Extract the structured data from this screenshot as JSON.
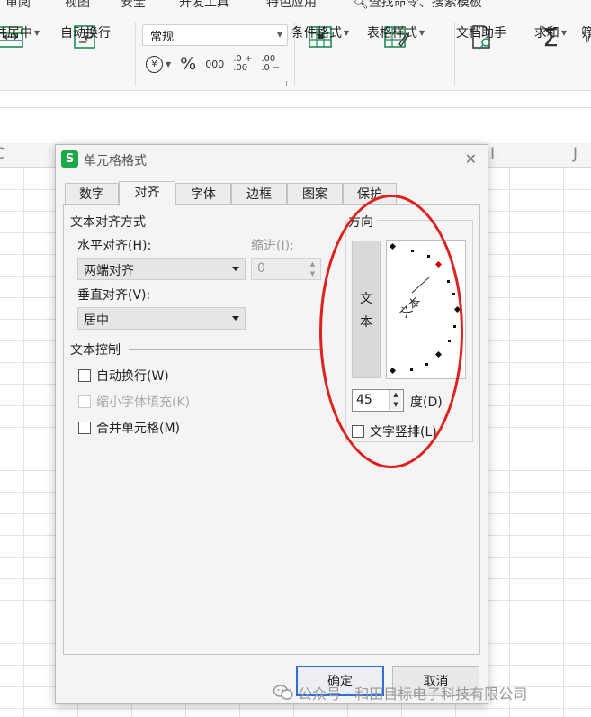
{
  "menu": {
    "items": [
      "审阅",
      "视图",
      "安全",
      "开发工具",
      "特色应用",
      "查找命令、搜索模板"
    ]
  },
  "ribbon": {
    "merge_center": "合并居中",
    "wrap_text": "自动换行",
    "number_format": "常规",
    "currency_symbol": "¥",
    "percent_symbol": "%",
    "thousands_symbol": "000",
    "increase_decimal": ".0 +\n.00",
    "decrease_decimal": ".00\n.0 −",
    "conditional_format": "条件格式",
    "table_style": "表格样式",
    "doc_assistant": "文档助手",
    "sum": "求和",
    "filter_partial": "筛"
  },
  "columns": [
    "C",
    "I",
    "J"
  ],
  "dialog": {
    "title": "单元格格式",
    "tabs": [
      "数字",
      "对齐",
      "字体",
      "边框",
      "图案",
      "保护"
    ],
    "active_tab": "对齐",
    "text_alignment_group": "文本对齐方式",
    "horizontal_label": "水平对齐(H):",
    "horizontal_value": "两端对齐",
    "indent_label": "缩进(I):",
    "indent_value": "0",
    "vertical_label": "垂直对齐(V):",
    "vertical_value": "居中",
    "text_control_group": "文本控制",
    "wrap_text": "自动换行(W)",
    "shrink_to_fit": "缩小字体填充(K)",
    "merge_cells": "合并单元格(M)",
    "orientation_group": "方向",
    "vertical_text_chars": [
      "文",
      "本"
    ],
    "dial_text": "文本",
    "degrees_value": "45",
    "degrees_label": "度(D)",
    "vertical_text_checkbox": "文字竖排(L)",
    "ok": "确定",
    "cancel": "取消"
  },
  "watermark": {
    "text": "公众号 · 和田目标电子科技有限公司"
  }
}
